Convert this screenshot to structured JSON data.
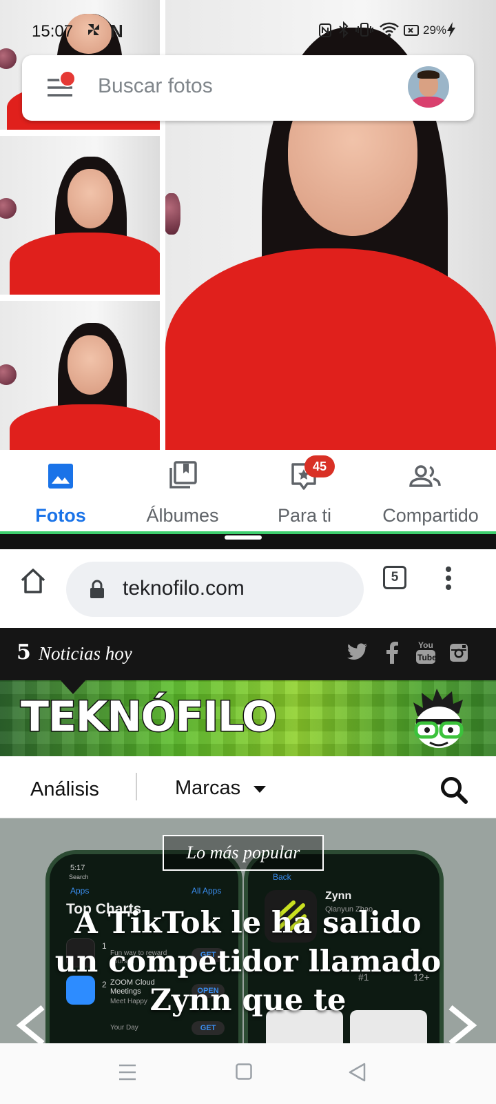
{
  "status_bar": {
    "time": "15:07",
    "battery": "29%",
    "icons": [
      "pinwheel-icon",
      "netflix-icon",
      "nfc-icon",
      "bluetooth-icon",
      "vibrate-icon",
      "wifi-icon",
      "battery-icon",
      "charging-icon"
    ]
  },
  "photos_app": {
    "search_placeholder": "Buscar fotos",
    "nav": [
      {
        "label": "Fotos",
        "icon": "photo-icon",
        "active": true
      },
      {
        "label": "Álbumes",
        "icon": "albums-icon",
        "active": false
      },
      {
        "label": "Para ti",
        "icon": "for-you-icon",
        "active": false,
        "badge": "45"
      },
      {
        "label": "Compartido",
        "icon": "shared-icon",
        "active": false
      }
    ],
    "accent": "#1a73e8",
    "badge_color": "#d93025"
  },
  "browser": {
    "url": "teknofilo.com",
    "tab_count": "5"
  },
  "site": {
    "topbar": {
      "count": "5",
      "label": "Noticias hoy"
    },
    "logo": "TEKNÓFILO",
    "menu": {
      "item1": "Análisis",
      "item2": "Marcas"
    },
    "hero": {
      "tag": "Lo más popular",
      "headline": "A TikTok le ha salido un competidor llamado Zynn que te"
    },
    "phone_left": {
      "time": "5:17",
      "back": "Search",
      "apps": "Apps",
      "all_apps": "All Apps",
      "title": "Top Charts",
      "rows": [
        {
          "rank": "1",
          "name": "",
          "sub": "Fun way to reward yourself",
          "action": "GET"
        },
        {
          "rank": "2",
          "name": "ZOOM Cloud Meetings",
          "sub": "Meet Happy",
          "action": "OPEN"
        },
        {
          "rank": "",
          "name": "",
          "sub": "Your Day",
          "action": "GET"
        }
      ]
    },
    "phone_right": {
      "back": "Back",
      "app_name": "Zynn",
      "developer": "Qianyun Zhao",
      "rank": "#1",
      "age": "12+"
    }
  }
}
